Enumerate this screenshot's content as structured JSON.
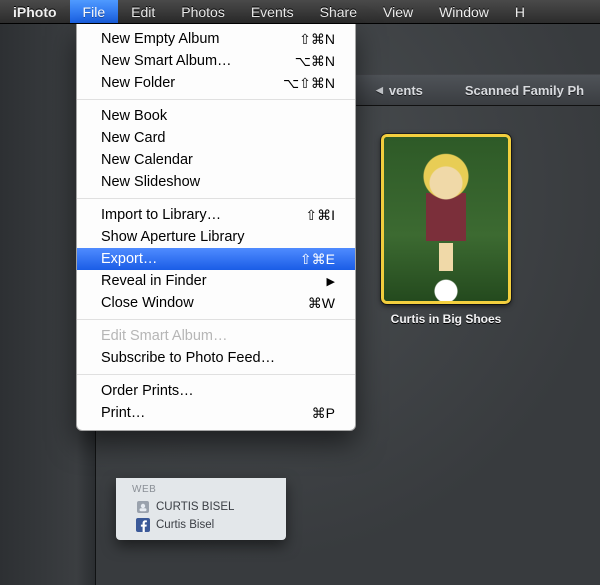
{
  "menubar": {
    "app": "iPhoto",
    "items": [
      "File",
      "Edit",
      "Photos",
      "Events",
      "Share",
      "View",
      "Window",
      "H"
    ],
    "open_index": 0
  },
  "file_menu": {
    "groups": [
      [
        {
          "label": "New Empty Album",
          "shortcut": "⇧⌘N"
        },
        {
          "label": "New Smart Album…",
          "shortcut": "⌥⌘N"
        },
        {
          "label": "New Folder",
          "shortcut": "⌥⇧⌘N"
        }
      ],
      [
        {
          "label": "New Book",
          "shortcut": ""
        },
        {
          "label": "New Card",
          "shortcut": ""
        },
        {
          "label": "New Calendar",
          "shortcut": ""
        },
        {
          "label": "New Slideshow",
          "shortcut": ""
        }
      ],
      [
        {
          "label": "Import to Library…",
          "shortcut": "⇧⌘I"
        },
        {
          "label": "Show Aperture Library",
          "shortcut": ""
        },
        {
          "label": "Export…",
          "shortcut": "⇧⌘E",
          "highlight": true
        },
        {
          "label": "Reveal in Finder",
          "shortcut": "",
          "submenu": true
        },
        {
          "label": "Close Window",
          "shortcut": "⌘W"
        }
      ],
      [
        {
          "label": "Edit Smart Album…",
          "shortcut": "",
          "disabled": true
        },
        {
          "label": "Subscribe to Photo Feed…",
          "shortcut": ""
        }
      ],
      [
        {
          "label": "Order Prints…",
          "shortcut": ""
        },
        {
          "label": "Print…",
          "shortcut": "⌘P"
        }
      ]
    ]
  },
  "event_bar": {
    "events_label": "vents",
    "tab_label": "Scanned Family Ph"
  },
  "photo": {
    "caption": "Curtis in Big Shoes"
  },
  "web_section": {
    "header": "WEB",
    "items": [
      {
        "icon": "mobileme-icon",
        "label": "CURTIS BISEL"
      },
      {
        "icon": "facebook-icon",
        "label": "Curtis Bisel"
      }
    ]
  },
  "colors": {
    "highlight": "#2a6ff0",
    "selection_border": "#f3cf3e"
  }
}
